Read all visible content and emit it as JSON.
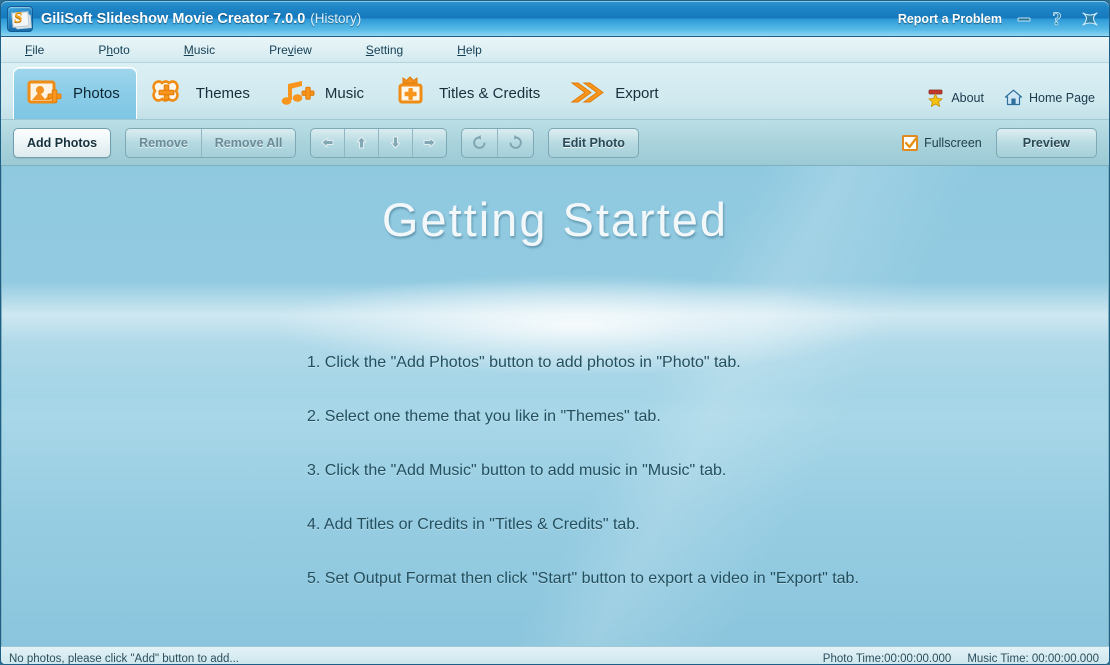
{
  "window": {
    "title": "GiliSoft Slideshow Movie Creator 7.0.0",
    "title_suffix": "(History)",
    "report_label": "Report a Problem",
    "app_icon": "slideshow-app-icon",
    "minimize_icon": "minimize-icon",
    "help_icon": "question-mark-icon",
    "close_icon": "close-icon"
  },
  "menubar": {
    "items": [
      {
        "pre": "",
        "key": "F",
        "post": "ile"
      },
      {
        "pre": "P",
        "key": "h",
        "post": "oto"
      },
      {
        "pre": "",
        "key": "M",
        "post": "usic"
      },
      {
        "pre": "Pre",
        "key": "v",
        "post": "iew"
      },
      {
        "pre": "",
        "key": "S",
        "post": "etting"
      },
      {
        "pre": "",
        "key": "H",
        "post": "elp"
      }
    ]
  },
  "tabs": [
    {
      "label": "Photos",
      "icon": "add-photo-icon",
      "active": true
    },
    {
      "label": "Themes",
      "icon": "add-theme-frame-icon",
      "active": false
    },
    {
      "label": "Music",
      "icon": "add-music-note-icon",
      "active": false
    },
    {
      "label": "Titles & Credits",
      "icon": "add-title-crown-icon",
      "active": false
    },
    {
      "label": "Export",
      "icon": "double-chevron-right-icon",
      "active": false
    }
  ],
  "tab_right": [
    {
      "label": "About",
      "icon": "about-star-icon"
    },
    {
      "label": "Home Page",
      "icon": "home-house-icon"
    }
  ],
  "toolbar": {
    "add_photos": "Add Photos",
    "remove": "Remove",
    "remove_all": "Remove All",
    "move_left_icon": "arrow-left-icon",
    "move_up_icon": "arrow-up-icon",
    "move_down_icon": "arrow-down-icon",
    "move_right_icon": "arrow-right-icon",
    "rotate_ccw_icon": "rotate-counterclockwise-icon",
    "rotate_cw_icon": "rotate-clockwise-icon",
    "edit_photo": "Edit Photo",
    "fullscreen_label": "Fullscreen",
    "fullscreen_checked": true,
    "preview": "Preview"
  },
  "stage": {
    "title": "Getting Started",
    "steps": [
      "1. Click the \"Add Photos\" button to add photos in \"Photo\" tab.",
      "2. Select one theme that you like in \"Themes\" tab.",
      "3. Click the \"Add Music\" button to add music in \"Music\" tab.",
      "4. Add Titles or Credits in \"Titles & Credits\" tab.",
      "5. Set Output Format then click \"Start\" button to export a video in \"Export\" tab."
    ]
  },
  "statusbar": {
    "message": "No photos, please click \"Add\" button to add...",
    "photo_time": "Photo Time:00:00:00.000",
    "music_time": "Music Time:  00:00:00.000"
  },
  "colors": {
    "titlebar_blue": "#1679bd",
    "accent_orange": "#f08c1a",
    "stage_blue": "#8fc9e0",
    "toolbar_teal": "#a9d3dc"
  }
}
